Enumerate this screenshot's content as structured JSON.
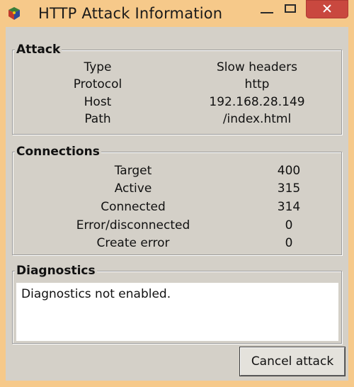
{
  "window": {
    "title": "HTTP Attack Information"
  },
  "attack": {
    "heading": "Attack",
    "rows": [
      {
        "label": "Type",
        "value": "Slow headers"
      },
      {
        "label": "Protocol",
        "value": "http"
      },
      {
        "label": "Host",
        "value": "192.168.28.149"
      },
      {
        "label": "Path",
        "value": "/index.html"
      }
    ]
  },
  "connections": {
    "heading": "Connections",
    "rows": [
      {
        "label": "Target",
        "value": "400"
      },
      {
        "label": "Active",
        "value": "315"
      },
      {
        "label": "Connected",
        "value": "314"
      },
      {
        "label": "Error/disconnected",
        "value": "0"
      },
      {
        "label": "Create error",
        "value": "0"
      }
    ]
  },
  "diagnostics": {
    "heading": "Diagnostics",
    "text": "Diagnostics not enabled."
  },
  "buttons": {
    "cancel": "Cancel attack"
  },
  "icons": {
    "app": "app-icon",
    "minimize": "minimize-icon",
    "maximize": "maximize-icon",
    "close": "close-icon"
  }
}
